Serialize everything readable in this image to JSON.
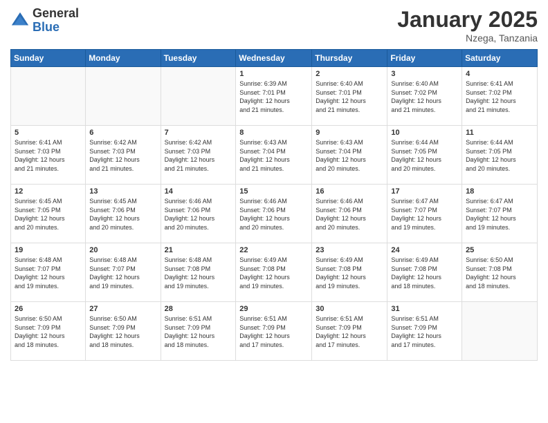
{
  "header": {
    "logo_general": "General",
    "logo_blue": "Blue",
    "title": "January 2025",
    "location": "Nzega, Tanzania"
  },
  "weekdays": [
    "Sunday",
    "Monday",
    "Tuesday",
    "Wednesday",
    "Thursday",
    "Friday",
    "Saturday"
  ],
  "weeks": [
    [
      {
        "day": "",
        "info": ""
      },
      {
        "day": "",
        "info": ""
      },
      {
        "day": "",
        "info": ""
      },
      {
        "day": "1",
        "info": "Sunrise: 6:39 AM\nSunset: 7:01 PM\nDaylight: 12 hours\nand 21 minutes."
      },
      {
        "day": "2",
        "info": "Sunrise: 6:40 AM\nSunset: 7:01 PM\nDaylight: 12 hours\nand 21 minutes."
      },
      {
        "day": "3",
        "info": "Sunrise: 6:40 AM\nSunset: 7:02 PM\nDaylight: 12 hours\nand 21 minutes."
      },
      {
        "day": "4",
        "info": "Sunrise: 6:41 AM\nSunset: 7:02 PM\nDaylight: 12 hours\nand 21 minutes."
      }
    ],
    [
      {
        "day": "5",
        "info": "Sunrise: 6:41 AM\nSunset: 7:03 PM\nDaylight: 12 hours\nand 21 minutes."
      },
      {
        "day": "6",
        "info": "Sunrise: 6:42 AM\nSunset: 7:03 PM\nDaylight: 12 hours\nand 21 minutes."
      },
      {
        "day": "7",
        "info": "Sunrise: 6:42 AM\nSunset: 7:03 PM\nDaylight: 12 hours\nand 21 minutes."
      },
      {
        "day": "8",
        "info": "Sunrise: 6:43 AM\nSunset: 7:04 PM\nDaylight: 12 hours\nand 21 minutes."
      },
      {
        "day": "9",
        "info": "Sunrise: 6:43 AM\nSunset: 7:04 PM\nDaylight: 12 hours\nand 20 minutes."
      },
      {
        "day": "10",
        "info": "Sunrise: 6:44 AM\nSunset: 7:05 PM\nDaylight: 12 hours\nand 20 minutes."
      },
      {
        "day": "11",
        "info": "Sunrise: 6:44 AM\nSunset: 7:05 PM\nDaylight: 12 hours\nand 20 minutes."
      }
    ],
    [
      {
        "day": "12",
        "info": "Sunrise: 6:45 AM\nSunset: 7:05 PM\nDaylight: 12 hours\nand 20 minutes."
      },
      {
        "day": "13",
        "info": "Sunrise: 6:45 AM\nSunset: 7:06 PM\nDaylight: 12 hours\nand 20 minutes."
      },
      {
        "day": "14",
        "info": "Sunrise: 6:46 AM\nSunset: 7:06 PM\nDaylight: 12 hours\nand 20 minutes."
      },
      {
        "day": "15",
        "info": "Sunrise: 6:46 AM\nSunset: 7:06 PM\nDaylight: 12 hours\nand 20 minutes."
      },
      {
        "day": "16",
        "info": "Sunrise: 6:46 AM\nSunset: 7:06 PM\nDaylight: 12 hours\nand 20 minutes."
      },
      {
        "day": "17",
        "info": "Sunrise: 6:47 AM\nSunset: 7:07 PM\nDaylight: 12 hours\nand 19 minutes."
      },
      {
        "day": "18",
        "info": "Sunrise: 6:47 AM\nSunset: 7:07 PM\nDaylight: 12 hours\nand 19 minutes."
      }
    ],
    [
      {
        "day": "19",
        "info": "Sunrise: 6:48 AM\nSunset: 7:07 PM\nDaylight: 12 hours\nand 19 minutes."
      },
      {
        "day": "20",
        "info": "Sunrise: 6:48 AM\nSunset: 7:07 PM\nDaylight: 12 hours\nand 19 minutes."
      },
      {
        "day": "21",
        "info": "Sunrise: 6:48 AM\nSunset: 7:08 PM\nDaylight: 12 hours\nand 19 minutes."
      },
      {
        "day": "22",
        "info": "Sunrise: 6:49 AM\nSunset: 7:08 PM\nDaylight: 12 hours\nand 19 minutes."
      },
      {
        "day": "23",
        "info": "Sunrise: 6:49 AM\nSunset: 7:08 PM\nDaylight: 12 hours\nand 19 minutes."
      },
      {
        "day": "24",
        "info": "Sunrise: 6:49 AM\nSunset: 7:08 PM\nDaylight: 12 hours\nand 18 minutes."
      },
      {
        "day": "25",
        "info": "Sunrise: 6:50 AM\nSunset: 7:08 PM\nDaylight: 12 hours\nand 18 minutes."
      }
    ],
    [
      {
        "day": "26",
        "info": "Sunrise: 6:50 AM\nSunset: 7:09 PM\nDaylight: 12 hours\nand 18 minutes."
      },
      {
        "day": "27",
        "info": "Sunrise: 6:50 AM\nSunset: 7:09 PM\nDaylight: 12 hours\nand 18 minutes."
      },
      {
        "day": "28",
        "info": "Sunrise: 6:51 AM\nSunset: 7:09 PM\nDaylight: 12 hours\nand 18 minutes."
      },
      {
        "day": "29",
        "info": "Sunrise: 6:51 AM\nSunset: 7:09 PM\nDaylight: 12 hours\nand 17 minutes."
      },
      {
        "day": "30",
        "info": "Sunrise: 6:51 AM\nSunset: 7:09 PM\nDaylight: 12 hours\nand 17 minutes."
      },
      {
        "day": "31",
        "info": "Sunrise: 6:51 AM\nSunset: 7:09 PM\nDaylight: 12 hours\nand 17 minutes."
      },
      {
        "day": "",
        "info": ""
      }
    ]
  ]
}
